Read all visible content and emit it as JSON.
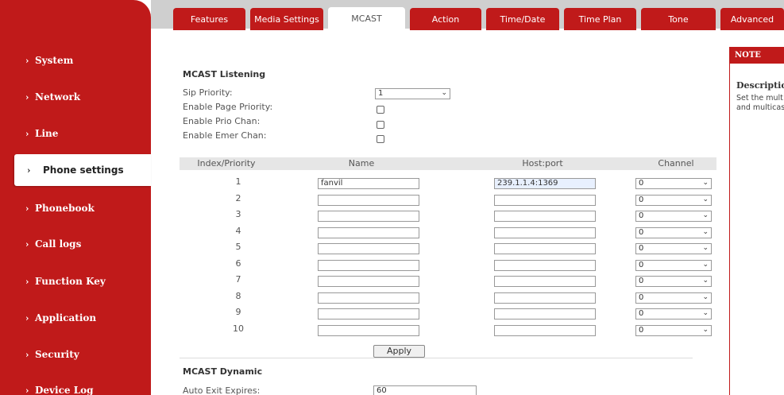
{
  "sidebar": {
    "items": [
      {
        "label": "System"
      },
      {
        "label": "Network"
      },
      {
        "label": "Line"
      },
      {
        "label": "Phone settings"
      },
      {
        "label": "Phonebook"
      },
      {
        "label": "Call logs"
      },
      {
        "label": "Function Key"
      },
      {
        "label": "Application"
      },
      {
        "label": "Security"
      },
      {
        "label": "Device Log"
      }
    ],
    "chevron": "›"
  },
  "tabs": [
    {
      "label": "Features"
    },
    {
      "label": "Media Settings"
    },
    {
      "label": "MCAST"
    },
    {
      "label": "Action"
    },
    {
      "label": "Time/Date"
    },
    {
      "label": "Time Plan"
    },
    {
      "label": "Tone"
    },
    {
      "label": "Advanced"
    }
  ],
  "listening": {
    "title": "MCAST Listening",
    "sip_priority_label": "Sip Priority:",
    "sip_priority_value": "1",
    "enable_page_priority_label": "Enable Page Priority:",
    "enable_prio_chan_label": "Enable Prio Chan:",
    "enable_emer_chan_label": "Enable Emer Chan:"
  },
  "table": {
    "headers": {
      "index": "Index/Priority",
      "name": "Name",
      "host": "Host:port",
      "channel": "Channel"
    },
    "rows": [
      {
        "index": "1",
        "name": "fanvil",
        "host": "239.1.1.4:1369",
        "channel": "0"
      },
      {
        "index": "2",
        "name": "",
        "host": "",
        "channel": "0"
      },
      {
        "index": "3",
        "name": "",
        "host": "",
        "channel": "0"
      },
      {
        "index": "4",
        "name": "",
        "host": "",
        "channel": "0"
      },
      {
        "index": "5",
        "name": "",
        "host": "",
        "channel": "0"
      },
      {
        "index": "6",
        "name": "",
        "host": "",
        "channel": "0"
      },
      {
        "index": "7",
        "name": "",
        "host": "",
        "channel": "0"
      },
      {
        "index": "8",
        "name": "",
        "host": "",
        "channel": "0"
      },
      {
        "index": "9",
        "name": "",
        "host": "",
        "channel": "0"
      },
      {
        "index": "10",
        "name": "",
        "host": "",
        "channel": "0"
      }
    ]
  },
  "apply_label": "Apply",
  "dynamic": {
    "title": "MCAST Dynamic",
    "auto_exit_label": "Auto Exit Expires:",
    "auto_exit_value": "60"
  },
  "note": {
    "title": "NOTE",
    "desc_title": "Description",
    "desc_line1": "Set the mult",
    "desc_line2": "and multicas"
  },
  "colors": {
    "accent": "#c01a1a",
    "tabbar": "#cfcfcf",
    "header_row": "#e6e6e6"
  }
}
